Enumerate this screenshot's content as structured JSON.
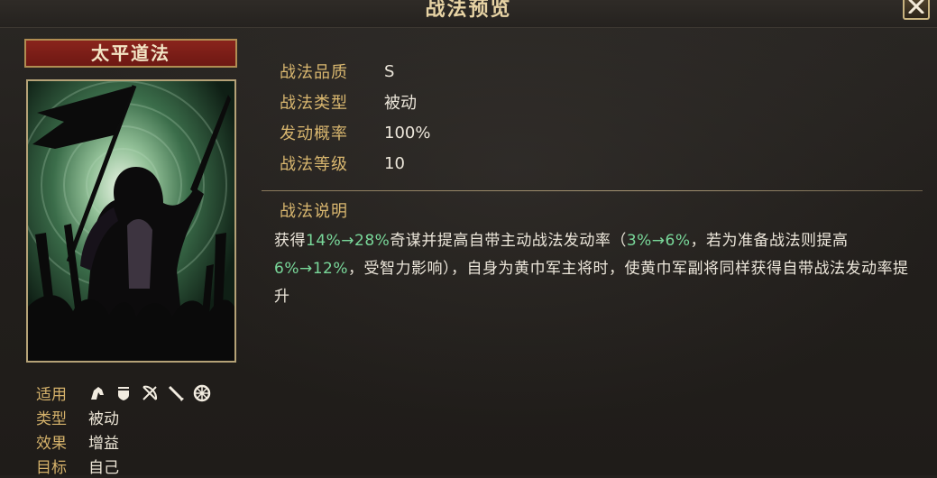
{
  "header": {
    "title": "战法预览"
  },
  "card": {
    "name": "太平道法"
  },
  "meta": {
    "apply_label": "适用",
    "type_label": "类型",
    "type_value": "被动",
    "effect_label": "效果",
    "effect_value": "增益",
    "target_label": "目标",
    "target_value": "自己",
    "troop_icons": [
      "cavalry-icon",
      "shield-icon",
      "bow-icon",
      "spear-icon",
      "wheel-icon"
    ]
  },
  "info": {
    "quality_label": "战法品质",
    "quality_value": "S",
    "type_label": "战法类型",
    "type_value": "被动",
    "rate_label": "发动概率",
    "rate_value": "100%",
    "level_label": "战法等级",
    "level_value": "10"
  },
  "description": {
    "title": "战法说明",
    "t1": "获得",
    "h1": "14%→28%",
    "t2": "奇谋并提高自带主动战法发动率（",
    "h2": "3%→6%",
    "t3": "，若为准备战法则提高",
    "h3": "6%→12%",
    "t4": "，受智力影响），自身为黄巾军主将时，使黄巾军副将同样获得自带战法发动率提升"
  },
  "colors": {
    "accent": "#d9b76f",
    "highlight": "#79d89a",
    "name_banner": "#7a1d16"
  }
}
